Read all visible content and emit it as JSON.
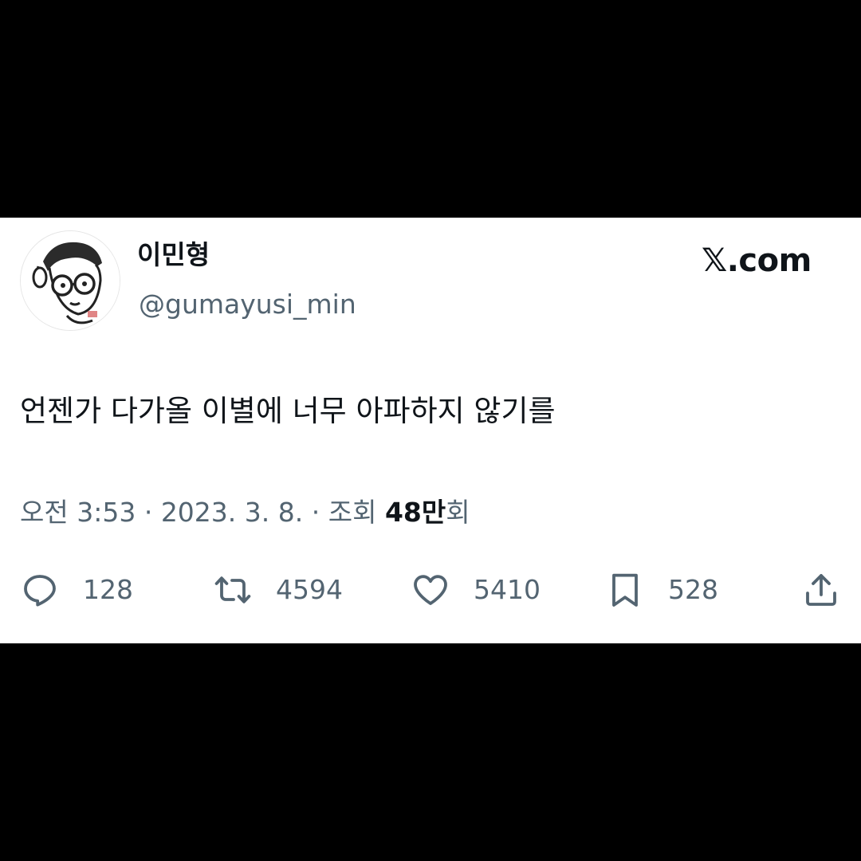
{
  "user": {
    "display_name": "이민형",
    "handle": "@gumayusi_min"
  },
  "brand": "𝕏.com",
  "tweet": {
    "text": "언젠가 다가올 이별에 너무 아파하지 않기를"
  },
  "meta": {
    "time": "오전 3:53",
    "separator": " · ",
    "date": "2023. 3. 8.",
    "views_label": "조회 ",
    "views_count": "48만",
    "views_suffix": "회"
  },
  "actions": {
    "reply": {
      "icon": "reply-icon",
      "count": "128"
    },
    "retweet": {
      "icon": "retweet-icon",
      "count": "4594"
    },
    "like": {
      "icon": "heart-icon",
      "count": "5410"
    },
    "bookmark": {
      "icon": "bookmark-icon",
      "count": "528"
    },
    "share": {
      "icon": "share-icon"
    }
  },
  "colors": {
    "text": "#0f1419",
    "secondary": "#536471",
    "background": "#ffffff",
    "frame": "#000000"
  }
}
